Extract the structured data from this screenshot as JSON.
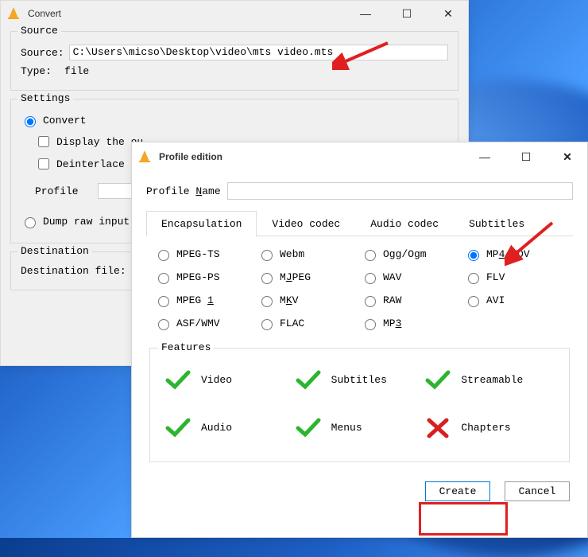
{
  "convert_window": {
    "title": "Convert",
    "source_group": "Source",
    "source_label": "Source:",
    "source_path": "C:\\Users\\micso\\Desktop\\video\\mts video.mts",
    "type_label": "Type:",
    "type_value": "file",
    "settings_group": "Settings",
    "opt_convert": "Convert",
    "chk_display": "Display the ou",
    "chk_deinterlace": "Deinterlace",
    "profile_label": "Profile",
    "opt_dump": "Dump raw input",
    "destination_group": "Destination",
    "destination_label": "Destination file:"
  },
  "profile_window": {
    "title": "Profile edition",
    "name_label_pre": "Profile ",
    "name_label_u": "N",
    "name_label_post": "ame",
    "tabs": [
      "Encapsulation",
      "Video codec",
      "Audio codec",
      "Subtitles"
    ],
    "radios": {
      "r0": "MPEG-TS",
      "r1": "Webm",
      "r2": "Ogg/Ogm",
      "r3_pre": "MP",
      "r3_u": "4",
      "r3_post": "/MOV",
      "r4": "MPEG-PS",
      "r5_pre": "M",
      "r5_u": "J",
      "r5_post": "PEG",
      "r6": "WAV",
      "r7": "FLV",
      "r8_pre": "MPEG ",
      "r8_u": "1",
      "r9_pre": "M",
      "r9_u": "K",
      "r9_post": "V",
      "r10": "RAW",
      "r11": "AVI",
      "r12": "ASF/WMV",
      "r13": "FLAC",
      "r14_pre": "MP",
      "r14_u": "3"
    },
    "features_group": "Features",
    "feat_video": "Video",
    "feat_subtitles": "Subtitles",
    "feat_streamable": "Streamable",
    "feat_audio": "Audio",
    "feat_menus": "Menus",
    "feat_chapters": "Chapters",
    "btn_create": "Create",
    "btn_cancel": "Cancel"
  },
  "icons": {
    "minimize": "—",
    "maximize": "☐",
    "close": "✕"
  }
}
